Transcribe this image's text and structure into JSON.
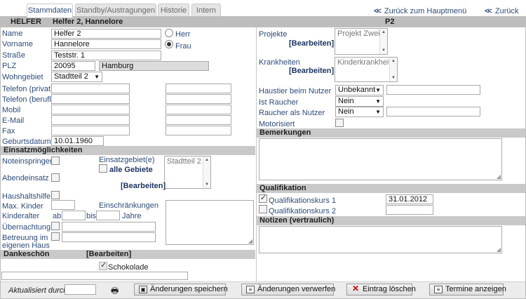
{
  "tabs": [
    "Stammdaten",
    "Standby/Austragungen",
    "Historie",
    "Intern"
  ],
  "nav": {
    "back_main_1": "Zurück zum Hauptmenü",
    "back_main_2": "Zurück"
  },
  "header": {
    "type": "HELFER",
    "name": "Helfer 2, Hannelore",
    "code": "P2"
  },
  "person": {
    "name_label": "Name",
    "name": "Helfer 2",
    "vorname_label": "Vorname",
    "vorname": "Hannelore",
    "strasse_label": "Straße",
    "strasse": "Teststr. 1",
    "plz_label": "PLZ",
    "plz": "20095",
    "ort": "Hamburg",
    "wohngebiet_label": "Wohngebiet",
    "wohngebiet": "Stadtteil 2",
    "herr": "Herr",
    "frau": "Frau",
    "tel_privat": "Telefon (privat)",
    "tel_beruf": "Telefon (berufl.)",
    "mobil": "Mobil",
    "email": "E-Mail",
    "fax": "Fax",
    "geburtsdatum_label": "Geburtsdatum",
    "geburtsdatum": "10.01.1960"
  },
  "einsatz": {
    "section": "Einsatzmöglichkeiten",
    "noteinspringer": "Noteinspringer",
    "abendeinsatz": "Abendeinsatz",
    "einsatzgebiete": "Einsatzgebiet(e)",
    "alle_gebiete": "alle Gebiete",
    "bearbeiten": "[Bearbeiten]",
    "gebiet_item": "Stadtteil 2",
    "haushaltshilfe": "Haushaltshilfe",
    "max_kinder": "Max. Kinder",
    "einschraenkungen": "Einschränkungen",
    "kinderalter": "Kinderalter",
    "ab": "ab",
    "bis": "bis",
    "jahre": "Jahre",
    "uebernachtung": "Übernachtung",
    "betreuung_1": "Betreuung im",
    "betreuung_2": "eigenen Haus"
  },
  "dankeschoen": {
    "section": "Dankeschön",
    "bearbeiten": "[Bearbeiten]",
    "item": "Schokolade"
  },
  "right": {
    "projekte": "Projekte",
    "projekte_bearbeiten": "[Bearbeiten]",
    "projekt_item": "Projekt Zwei",
    "krankheiten": "Krankheiten",
    "krankheiten_bearbeiten": "[Bearbeiten]",
    "krankheit_item": "Kinderkrankheit",
    "haustier_label": "Haustier beim Nutzer",
    "haustier": "Unbekannt",
    "raucher_label": "Ist Raucher",
    "raucher": "Nein",
    "raucher_nutzer_label": "Raucher als Nutzer",
    "raucher_nutzer": "Nein",
    "motorisiert": "Motorisiert",
    "bemerkungen": "Bemerkungen",
    "qualifikation": "Qualifikation",
    "kurs1": "Qualifikationskurs 1",
    "kurs1_datum": "31.01.2012",
    "kurs2": "Qualifikationskurs 2",
    "notizen": "Notizen (vertraulich)"
  },
  "footer": {
    "aktualisiert": "Aktualisiert durch",
    "save": "Änderungen speichern",
    "discard": "Änderungen verwerfen",
    "delete": "Eintrag löschen",
    "termine": "Termine anzeigen"
  }
}
